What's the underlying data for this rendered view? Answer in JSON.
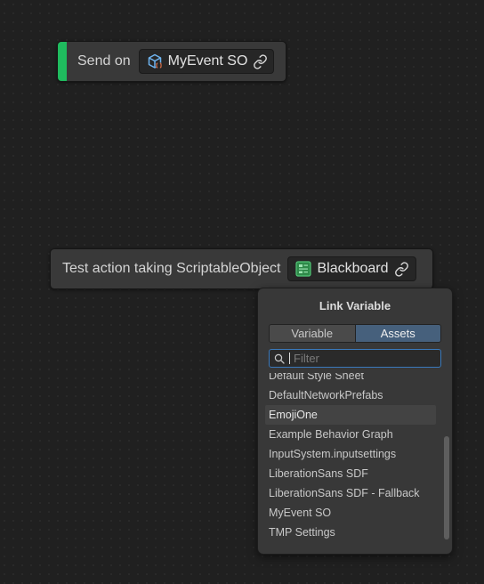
{
  "colors": {
    "canvas_bg": "#202020",
    "node_bg": "#393939",
    "accent_green": "#1fbb5e",
    "tab_active": "#46607c",
    "filter_border": "#3a79bb"
  },
  "send_node": {
    "label": "Send on",
    "variable": {
      "icon": "scriptable-object-icon",
      "name": "MyEvent SO",
      "link_icon": "link-icon"
    }
  },
  "test_node": {
    "label": "Test action taking ScriptableObject",
    "variable": {
      "icon": "blackboard-icon",
      "name": "Blackboard",
      "link_icon": "link-icon"
    }
  },
  "link_popup": {
    "title": "Link Variable",
    "tabs": [
      {
        "label": "Variable",
        "active": false
      },
      {
        "label": "Assets",
        "active": true
      }
    ],
    "filter": {
      "placeholder": "Filter",
      "value": ""
    },
    "items": [
      "Default Style Sheet",
      "DefaultNetworkPrefabs",
      "EmojiOne",
      "Example Behavior Graph",
      "InputSystem.inputsettings",
      "LiberationSans SDF",
      "LiberationSans SDF - Fallback",
      "MyEvent SO",
      "TMP Settings"
    ],
    "hovered_item": "EmojiOne"
  }
}
